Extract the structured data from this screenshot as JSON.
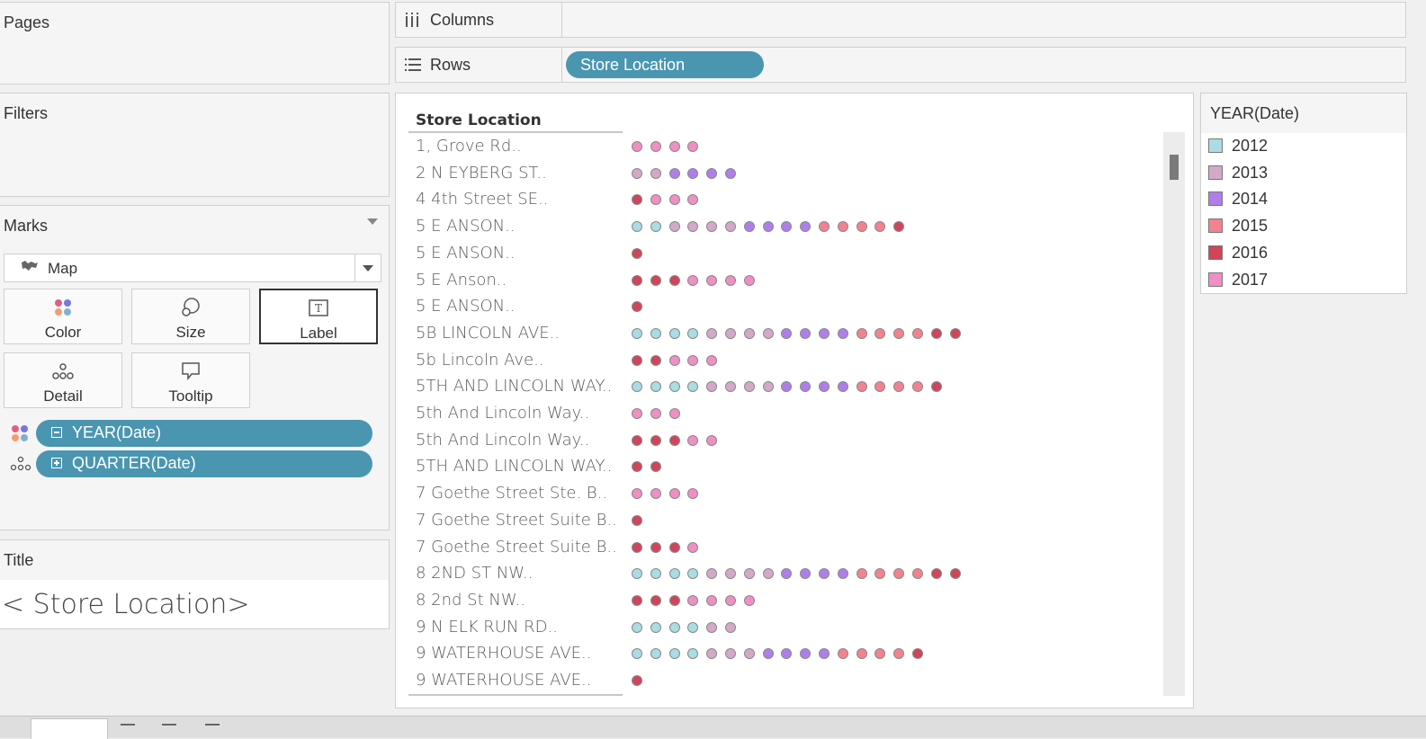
{
  "cards": {
    "pages": {
      "title": "Pages"
    },
    "filters": {
      "title": "Filters"
    },
    "marks": {
      "title": "Marks",
      "mark_type": "Map",
      "buttons": {
        "color": "Color",
        "size": "Size",
        "label": "Label",
        "detail": "Detail",
        "tooltip": "Tooltip"
      },
      "pills": [
        {
          "label": "YEAR(Date)",
          "expander": "minus",
          "encoding": "color"
        },
        {
          "label": "QUARTER(Date)",
          "expander": "plus",
          "encoding": "detail"
        }
      ]
    },
    "title": {
      "title": "Title",
      "text": "< Store Location>"
    }
  },
  "shelves": {
    "columns": {
      "label": "Columns"
    },
    "rows": {
      "label": "Rows",
      "pill": "Store Location"
    }
  },
  "view": {
    "header": "Store Location",
    "colors": {
      "2012": "#a8dde3",
      "2013": "#d4a9c8",
      "2014": "#b07ee8",
      "2015": "#f38291",
      "2016": "#d0455a",
      "2017": "#f08fc4"
    },
    "rows": [
      {
        "label": "1, Grove Rd..",
        "marks": [
          "2017",
          "2017",
          "2017",
          "2017"
        ]
      },
      {
        "label": "2 N EYBERG ST..",
        "marks": [
          "2013",
          "2013",
          "2014",
          "2014",
          "2014",
          "2014"
        ]
      },
      {
        "label": "4 4th Street SE..",
        "marks": [
          "2016",
          "2017",
          "2017",
          "2017"
        ]
      },
      {
        "label": "5 E ANSON..",
        "marks": [
          "2012",
          "2012",
          "2013",
          "2013",
          "2013",
          "2013",
          "2014",
          "2014",
          "2014",
          "2014",
          "2015",
          "2015",
          "2015",
          "2015",
          "2016"
        ]
      },
      {
        "label": "5 E ANSON..",
        "marks": [
          "2016"
        ]
      },
      {
        "label": "5 E Anson..",
        "marks": [
          "2016",
          "2016",
          "2016",
          "2017",
          "2017",
          "2017",
          "2017"
        ]
      },
      {
        "label": "5 E ANSON..",
        "marks": [
          "2016"
        ]
      },
      {
        "label": "5B LINCOLN AVE..",
        "marks": [
          "2012",
          "2012",
          "2012",
          "2012",
          "2013",
          "2013",
          "2013",
          "2013",
          "2014",
          "2014",
          "2014",
          "2014",
          "2015",
          "2015",
          "2015",
          "2015",
          "2016",
          "2016"
        ]
      },
      {
        "label": "5b Lincoln Ave..",
        "marks": [
          "2016",
          "2016",
          "2017",
          "2017",
          "2017"
        ]
      },
      {
        "label": "5TH AND LINCOLN WAY..",
        "marks": [
          "2012",
          "2012",
          "2012",
          "2012",
          "2013",
          "2013",
          "2013",
          "2013",
          "2014",
          "2014",
          "2014",
          "2014",
          "2015",
          "2015",
          "2015",
          "2015",
          "2016"
        ]
      },
      {
        "label": "5th And Lincoln Way..",
        "marks": [
          "2017",
          "2017",
          "2017"
        ]
      },
      {
        "label": "5th And Lincoln Way..",
        "marks": [
          "2016",
          "2016",
          "2016",
          "2017",
          "2017"
        ]
      },
      {
        "label": "5TH AND LINCOLN WAY..",
        "marks": [
          "2016",
          "2016"
        ]
      },
      {
        "label": "7 Goethe Street Ste. B..",
        "marks": [
          "2017",
          "2017",
          "2017",
          "2017"
        ]
      },
      {
        "label": "7 Goethe Street Suite B..",
        "marks": [
          "2016"
        ]
      },
      {
        "label": "7 Goethe Street Suite B..",
        "marks": [
          "2016",
          "2016",
          "2016",
          "2017"
        ]
      },
      {
        "label": "8 2ND ST NW..",
        "marks": [
          "2012",
          "2012",
          "2012",
          "2012",
          "2013",
          "2013",
          "2013",
          "2013",
          "2014",
          "2014",
          "2014",
          "2014",
          "2015",
          "2015",
          "2015",
          "2015",
          "2016",
          "2016"
        ]
      },
      {
        "label": "8 2nd St NW..",
        "marks": [
          "2016",
          "2016",
          "2016",
          "2017",
          "2017",
          "2017",
          "2017"
        ]
      },
      {
        "label": "9 N ELK RUN RD..",
        "marks": [
          "2012",
          "2012",
          "2012",
          "2012",
          "2013",
          "2013"
        ]
      },
      {
        "label": "9 WATERHOUSE AVE..",
        "marks": [
          "2012",
          "2012",
          "2012",
          "2012",
          "2013",
          "2013",
          "2013",
          "2014",
          "2014",
          "2014",
          "2014",
          "2015",
          "2015",
          "2015",
          "2015",
          "2016"
        ]
      },
      {
        "label": "9 WATERHOUSE AVE..",
        "marks": [
          "2016"
        ]
      }
    ]
  },
  "legend": {
    "title": "YEAR(Date)",
    "items": [
      {
        "label": "2012",
        "color": "#a8dde3"
      },
      {
        "label": "2013",
        "color": "#d4a9c8"
      },
      {
        "label": "2014",
        "color": "#b07ee8"
      },
      {
        "label": "2015",
        "color": "#f38291"
      },
      {
        "label": "2016",
        "color": "#d0455a"
      },
      {
        "label": "2017",
        "color": "#f08fc4"
      }
    ]
  }
}
